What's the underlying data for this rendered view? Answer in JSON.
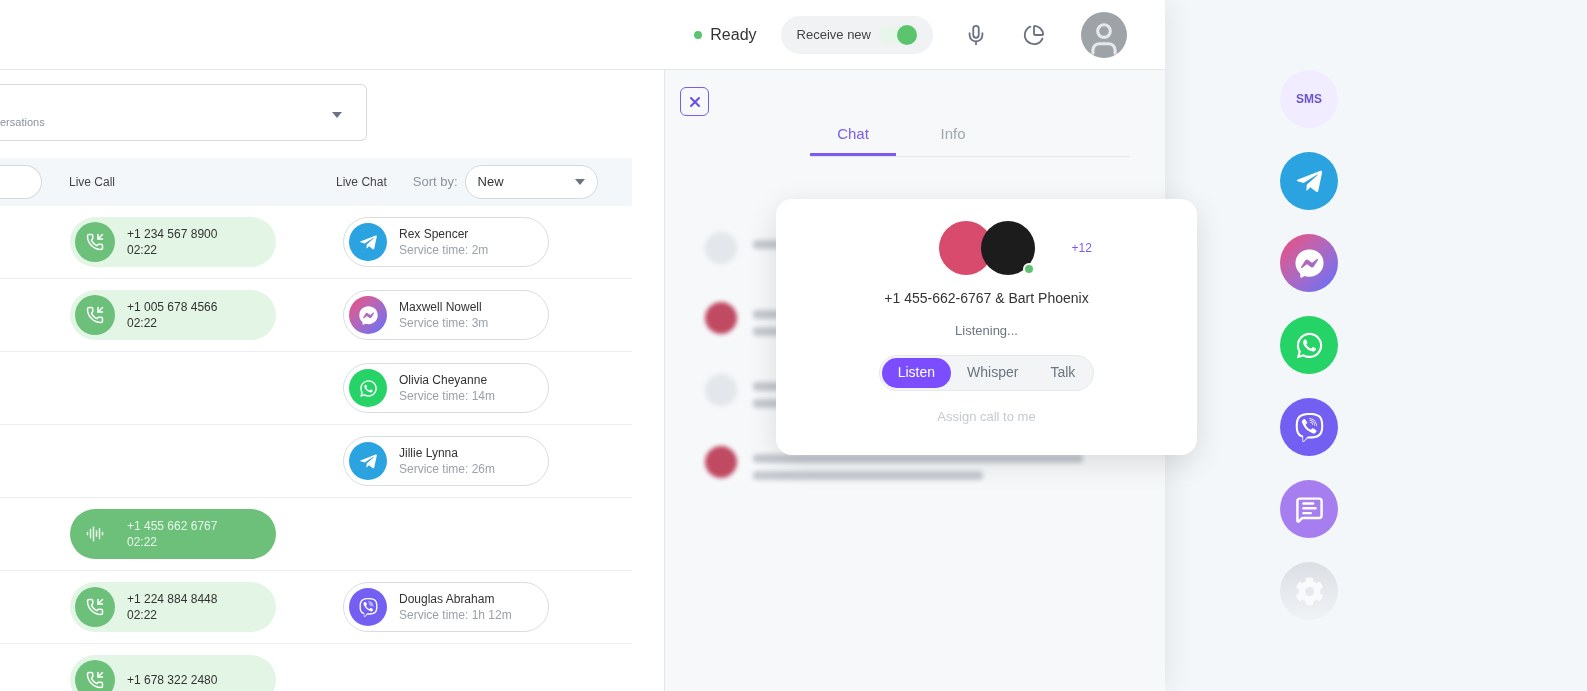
{
  "header": {
    "status": {
      "label": "Ready",
      "online": true
    },
    "receive_new": {
      "label": "Receive new",
      "on": true
    }
  },
  "filter": {
    "dropdown_text": "ersations"
  },
  "columns": {
    "call": "Live Call",
    "chat": "Live Chat",
    "sort_label": "Sort by:",
    "sort_value": "New"
  },
  "rows": [
    {
      "call": {
        "phone": "+1 234 567 8900",
        "time": "02:22",
        "active": false
      },
      "chat": {
        "kind": "telegram",
        "name": "Rex Spencer",
        "service": "Service time: 2m"
      }
    },
    {
      "call": {
        "phone": "+1 005 678 4566",
        "time": "02:22",
        "active": false
      },
      "chat": {
        "kind": "messenger",
        "name": "Maxwell Nowell",
        "service": "Service time: 3m"
      }
    },
    {
      "chat": {
        "kind": "whatsapp",
        "name": "Olivia Cheyanne",
        "service": "Service time: 14m"
      }
    },
    {
      "chat": {
        "kind": "telegram",
        "name": "Jillie Lynna",
        "service": "Service time: 26m"
      }
    },
    {
      "call": {
        "phone": "+1 455 662 6767",
        "time": "02:22",
        "active": true
      }
    },
    {
      "call": {
        "phone": "+1 224 884 8448",
        "time": "02:22",
        "active": false
      },
      "chat": {
        "kind": "viber",
        "name": "Douglas Abraham",
        "service": "Service time: 1h 12m"
      }
    },
    {
      "call": {
        "phone": "+1 678 322 2480",
        "active": false
      }
    }
  ],
  "chat_panel": {
    "tabs": [
      {
        "label": "Chat",
        "selected": true
      },
      {
        "label": "Info",
        "selected": false
      }
    ]
  },
  "call_popup": {
    "more": "+12",
    "title": "+1 455-662-6767 & Bart Phoenix",
    "status": "Listening...",
    "modes": [
      {
        "label": "Listen",
        "selected": true
      },
      {
        "label": "Whisper",
        "selected": false
      },
      {
        "label": "Talk",
        "selected": false
      }
    ],
    "assign": "Assign call to me"
  },
  "channels": [
    {
      "kind": "sms",
      "label": "SMS",
      "dimmed": true
    },
    {
      "kind": "telegram",
      "dimmed": false
    },
    {
      "kind": "messenger",
      "dimmed": false
    },
    {
      "kind": "whatsapp",
      "dimmed": false
    },
    {
      "kind": "viber",
      "dimmed": false
    },
    {
      "kind": "chat",
      "dimmed": false
    },
    {
      "kind": "settings",
      "dimmed": true
    }
  ]
}
